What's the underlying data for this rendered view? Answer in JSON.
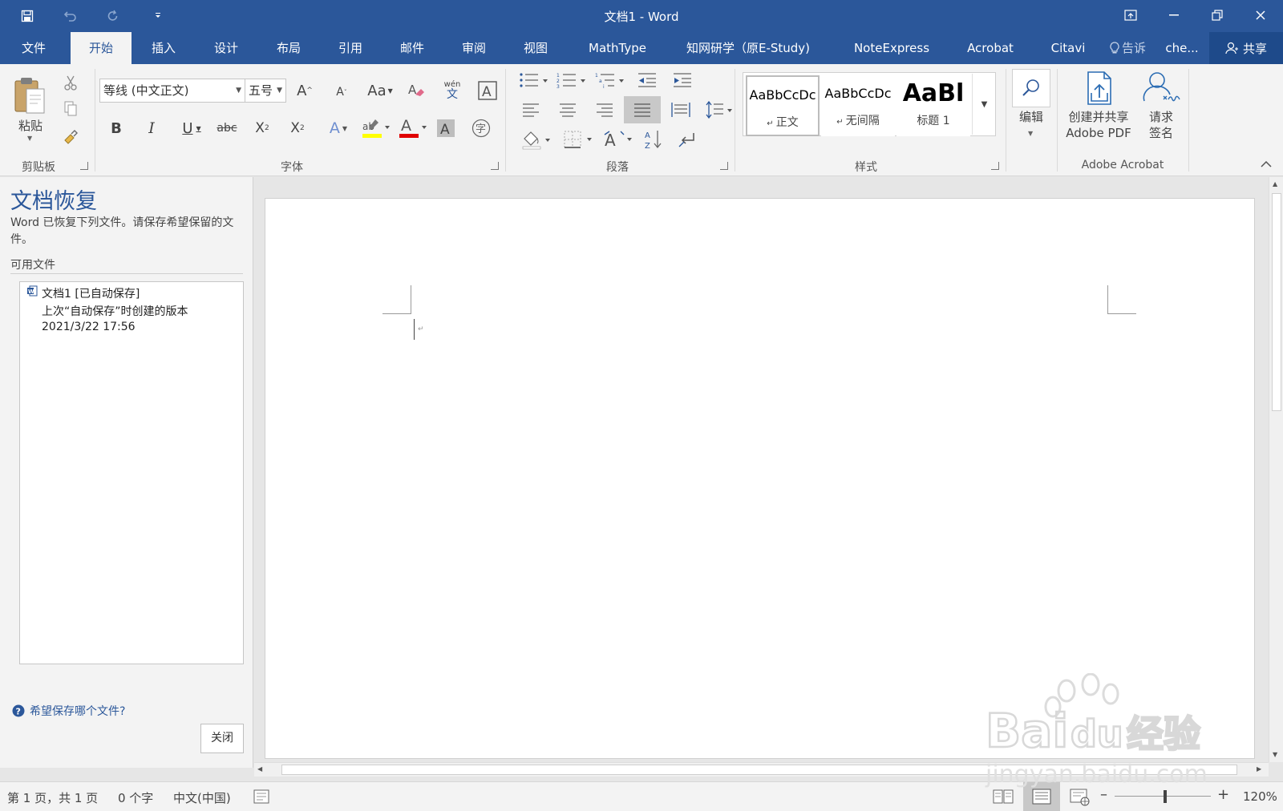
{
  "window": {
    "title": "文档1 - Word",
    "accent": "#2b579a"
  },
  "quick_access": {
    "icons": [
      "save-icon",
      "undo-icon",
      "redo-icon",
      "customize-qat-icon"
    ]
  },
  "tabs": {
    "items": [
      {
        "label": "文件"
      },
      {
        "label": "开始"
      },
      {
        "label": "插入"
      },
      {
        "label": "设计"
      },
      {
        "label": "布局"
      },
      {
        "label": "引用"
      },
      {
        "label": "邮件"
      },
      {
        "label": "审阅"
      },
      {
        "label": "视图"
      },
      {
        "label": "MathType"
      },
      {
        "label": "知网研学（原E-Study)"
      },
      {
        "label": "NoteExpress"
      },
      {
        "label": "Acrobat"
      },
      {
        "label": "Citavi"
      }
    ],
    "active": "开始",
    "tell_me": "告诉",
    "user": "che...",
    "share": "共享"
  },
  "ribbon": {
    "clipboard": {
      "paste_label": "粘贴",
      "group_label": "剪贴板"
    },
    "font": {
      "font_name": "等线 (中文正文)",
      "font_size": "五号",
      "group_label": "字体",
      "phonetic_top": "wén",
      "phonetic_bottom": "文",
      "case_label": "Aa"
    },
    "paragraph": {
      "group_label": "段落"
    },
    "styles": {
      "group_label": "样式",
      "items": [
        {
          "sample": "AaBbCcDc",
          "name": "正文"
        },
        {
          "sample": "AaBbCcDc",
          "name": "无间隔"
        },
        {
          "sample": "AaBl",
          "name": "标题 1"
        }
      ]
    },
    "editing": {
      "label": "编辑"
    },
    "acrobat": {
      "create_share_line1": "创建并共享",
      "create_share_line2": "Adobe PDF",
      "request_sign_line1": "请求",
      "request_sign_line2": "签名",
      "group_label": "Adobe Acrobat"
    }
  },
  "recovery": {
    "title": "文档恢复",
    "description": "Word 已恢复下列文件。请保存希望保留的文件。",
    "available_label": "可用文件",
    "files": [
      {
        "name": "文档1  [已自动保存]",
        "note": "上次“自动保存”时创建的版本",
        "timestamp": "2021/3/22 17:56"
      }
    ],
    "help_link": "希望保存哪个文件?",
    "close_label": "关闭"
  },
  "status": {
    "page": "第 1 页，共 1 页",
    "words": "0 个字",
    "language": "中文(中国)",
    "zoom": "120%",
    "zoom_value": 120
  },
  "watermark": {
    "brand": "Bai",
    "brand2": "du",
    "cn": "经验",
    "url": "jingyan.baidu.com"
  }
}
